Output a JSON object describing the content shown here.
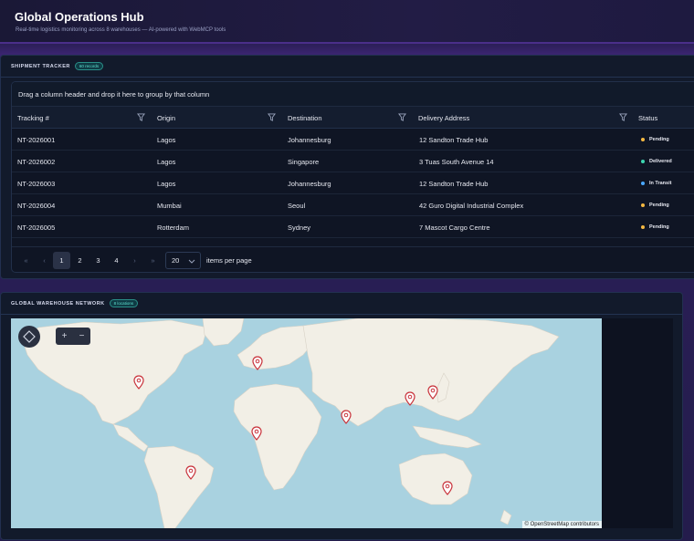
{
  "header": {
    "title": "Global Operations Hub",
    "subtitle": "Real-time logistics monitoring across 8 warehouses — AI-powered with WebMCP tools"
  },
  "shipments": {
    "title": "SHIPMENT TRACKER",
    "badge": "60 records",
    "group_hint": "Drag a column header and drop it here to group by that column",
    "columns": [
      "Tracking #",
      "Origin",
      "Destination",
      "Delivery Address",
      "Status"
    ],
    "rows": [
      {
        "tracking": "NT-2026001",
        "origin": "Lagos",
        "destination": "Johannesburg",
        "address": "12 Sandton Trade Hub",
        "status": "Pending",
        "status_color": "#f5b942"
      },
      {
        "tracking": "NT-2026002",
        "origin": "Lagos",
        "destination": "Singapore",
        "address": "3 Tuas South Avenue 14",
        "status": "Delivered",
        "status_color": "#3dd6b0"
      },
      {
        "tracking": "NT-2026003",
        "origin": "Lagos",
        "destination": "Johannesburg",
        "address": "12 Sandton Trade Hub",
        "status": "In Transit",
        "status_color": "#4aa8ff"
      },
      {
        "tracking": "NT-2026004",
        "origin": "Mumbai",
        "destination": "Seoul",
        "address": "42 Guro Digital Industrial Complex",
        "status": "Pending",
        "status_color": "#f5b942"
      },
      {
        "tracking": "NT-2026005",
        "origin": "Rotterdam",
        "destination": "Sydney",
        "address": "7 Mascot Cargo Centre",
        "status": "Pending",
        "status_color": "#f5b942"
      }
    ],
    "pager": {
      "first": "«",
      "prev": "‹",
      "pages": [
        "1",
        "2",
        "3",
        "4"
      ],
      "next": "›",
      "last": "»",
      "page_size": "20",
      "page_size_label": "items per page"
    }
  },
  "warehouses": {
    "title": "GLOBAL WAREHOUSE NETWORK",
    "badge": "8 locations",
    "zoom_in": "+",
    "zoom_out": "−",
    "attribution": "© OpenStreetMap contributors"
  }
}
